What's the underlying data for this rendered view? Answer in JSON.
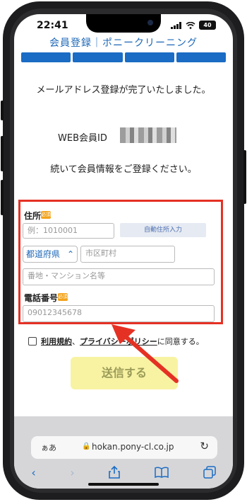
{
  "status_bar": {
    "time": "22:41",
    "battery": "40"
  },
  "page": {
    "site_title": "会員登録｜ポニークリーニング",
    "steps": 4,
    "completion_message": "メールアドレス登録が完了いたしました。",
    "webid_label": "WEB会員ID",
    "instruction": "続いて会員情報をご登録ください。"
  },
  "form": {
    "address_label": "住所",
    "required_badge": "必須",
    "postal_placeholder": "例：1010001",
    "auto_address_button": "自動住所入力",
    "prefecture_select": "都道府県",
    "city_placeholder": "市区町村",
    "street_placeholder": "番地・マンション名等",
    "phone_label": "電話番号",
    "phone_placeholder": "09012345678"
  },
  "agreement": {
    "terms_link": "利用規約",
    "separator": "、",
    "privacy_link": "プライバシーポリシー",
    "suffix": "に同意する。"
  },
  "submit": {
    "label": "送信する"
  },
  "browser": {
    "text_size": "ぁあ",
    "url": "hokan.pony-cl.co.jp",
    "icons": [
      "back-icon",
      "forward-icon",
      "share-icon",
      "bookmarks-icon",
      "tabs-icon"
    ]
  },
  "colors": {
    "accent": "#1a6cc4",
    "highlight": "#e53124",
    "submit_bg": "#f8f3a3",
    "required": "#f2a31b"
  }
}
